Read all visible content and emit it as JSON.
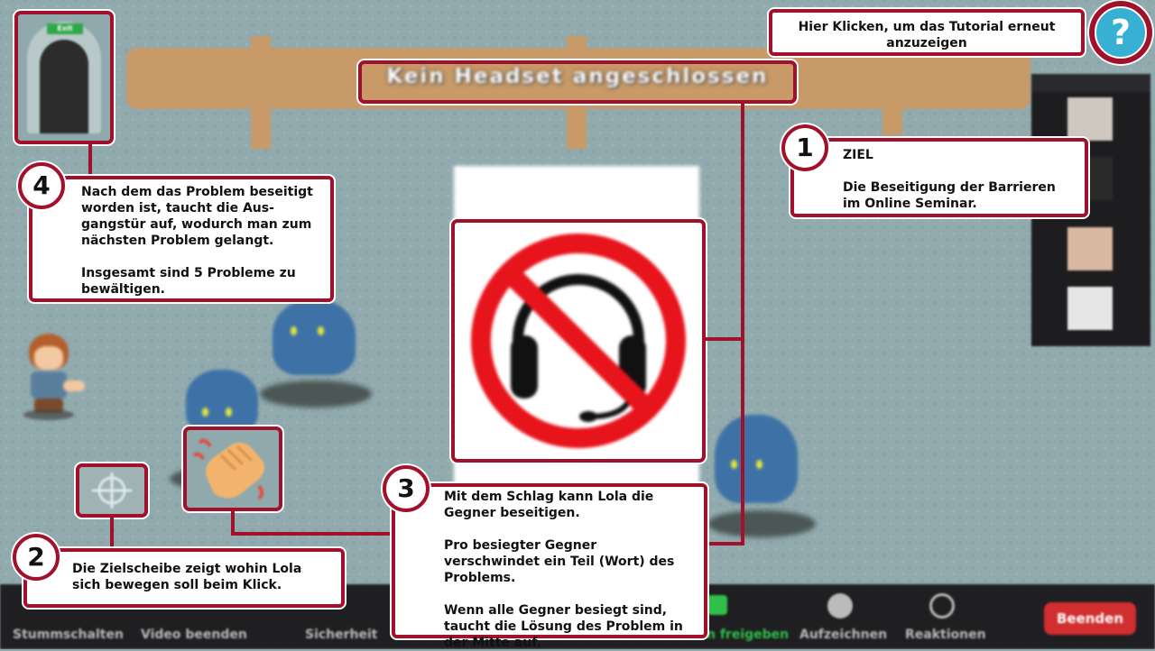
{
  "scene": {
    "banner_title": "Kein Headset angeschlossen",
    "exit_sign": "Exit"
  },
  "help": {
    "tooltip": "Hier Klicken, um das Tutorial erneut anzuzeigen",
    "icon": "?"
  },
  "tutorial": {
    "step1": {
      "number": "1",
      "text": "ZIEL\n\nDie Beseitigung der Barrieren im Online Seminar."
    },
    "step2": {
      "number": "2",
      "text": "Die Zielscheibe zeigt wohin Lola sich bewegen soll beim Klick."
    },
    "step3": {
      "number": "3",
      "text": "Mit dem Schlag kann Lola die Gegner beseitigen.\n\nPro besiegter Gegner verschwindet ein Teil (Wort) des Problems.\n\nWenn alle Gegner besiegt sind, taucht die Lösung des Problem in der Mitte auf."
    },
    "step4": {
      "number": "4",
      "text": "Nach dem das Problem beseitigt worden ist, taucht die Aus-gangstür auf, wodurch man zum nächsten Problem gelangt.\n\nInsgesamt sind 5 Probleme zu bewältigen."
    }
  },
  "meeting_toolbar": {
    "mute": "Stummschalten",
    "video": "Video beenden",
    "security": "Sicherheit",
    "share": "n freigeben",
    "record": "Aufzeichnen",
    "reactions": "Reaktionen",
    "end": "Beenden"
  },
  "colors": {
    "accent": "#a1112b",
    "help_blue": "#38b0d3",
    "end_red": "#d12f2f"
  }
}
